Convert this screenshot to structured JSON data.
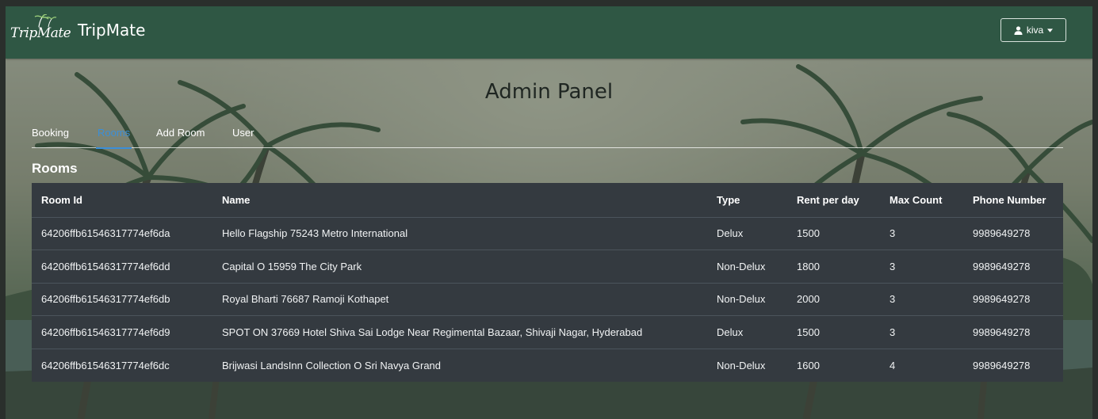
{
  "navbar": {
    "logo_text": "TripMate",
    "brand_name": "TripMate",
    "user_label": "kiva"
  },
  "page": {
    "title": "Admin Panel"
  },
  "tabs": [
    {
      "label": "Booking",
      "active": false
    },
    {
      "label": "Rooms",
      "active": true
    },
    {
      "label": "Add Room",
      "active": false
    },
    {
      "label": "User",
      "active": false
    }
  ],
  "section": {
    "title": "Rooms"
  },
  "table": {
    "headers": [
      "Room Id",
      "Name",
      "Type",
      "Rent per day",
      "Max Count",
      "Phone Number"
    ],
    "rows": [
      [
        "64206ffb61546317774ef6da",
        "Hello Flagship 75243 Metro International",
        "Delux",
        "1500",
        "3",
        "9989649278"
      ],
      [
        "64206ffb61546317774ef6dd",
        "Capital O 15959 The City Park",
        "Non-Delux",
        "1800",
        "3",
        "9989649278"
      ],
      [
        "64206ffb61546317774ef6db",
        "Royal Bharti 76687 Ramoji Kothapet",
        "Non-Delux",
        "2000",
        "3",
        "9989649278"
      ],
      [
        "64206ffb61546317774ef6d9",
        "SPOT ON 37669 Hotel Shiva Sai Lodge Near Regimental Bazaar, Shivaji Nagar, Hyderabad",
        "Delux",
        "1500",
        "3",
        "9989649278"
      ],
      [
        "64206ffb61546317774ef6dc",
        "Brijwasi LandsInn Collection O Sri Navya Grand",
        "Non-Delux",
        "1600",
        "4",
        "9989649278"
      ]
    ]
  },
  "icons": {
    "user": "user-icon",
    "caret": "caret-down-icon",
    "logo_palm": "palm-tree-icon"
  },
  "colors": {
    "navbar": "#2f5744",
    "table_bg": "#343a40",
    "active_tab": "#3b8fd8"
  }
}
